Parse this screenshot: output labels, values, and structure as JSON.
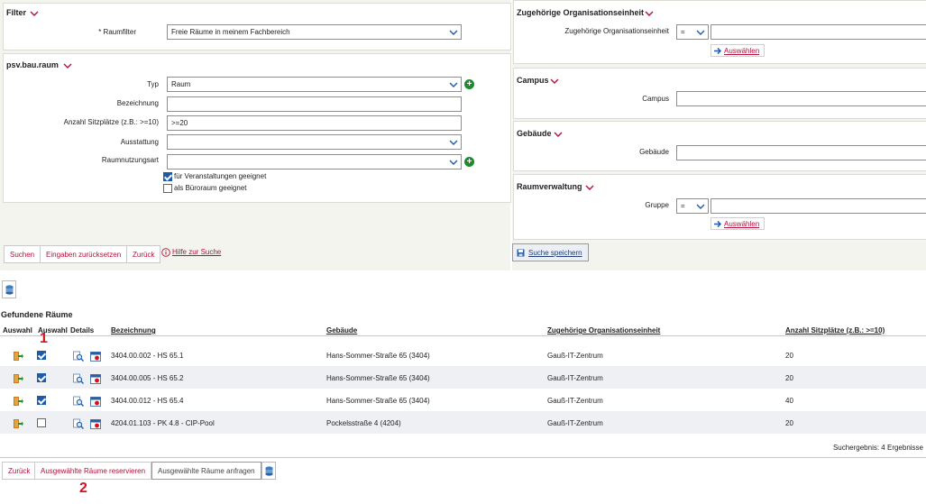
{
  "filter": {
    "title": "Filter",
    "raumfilter_label": "* Raumfilter",
    "raumfilter_value": "Freie Räume in meinem Fachbereich"
  },
  "psv": {
    "title": "psv.bau.raum",
    "typ_label": "Typ",
    "typ_value": "Raum",
    "bezeichnung_label": "Bezeichnung",
    "bezeichnung_value": "",
    "sitzplaetze_label": "Anzahl Sitzplätze (z.B.: >=10)",
    "sitzplaetze_value": ">=20",
    "ausstattung_label": "Ausstattung",
    "ausstattung_value": "",
    "raumnutzungsart_label": "Raumnutzungsart",
    "raumnutzungsart_value": "",
    "cb_veranstaltungen": "für Veranstaltungen geeignet",
    "cb_veranstaltungen_checked": true,
    "cb_buero": "als Büroraum geeignet",
    "cb_buero_checked": false
  },
  "left_buttons": {
    "suchen": "Suchen",
    "reset": "Eingaben zurücksetzen",
    "zurueck": "Zurück",
    "hilfe": "Hilfe zur Suche"
  },
  "org": {
    "title": "Zugehörige Organisationseinheit",
    "label": "Zugehörige Organisationseinheit",
    "operator": "=",
    "value": "",
    "auswaehlen": "Auswählen"
  },
  "campus": {
    "title": "Campus",
    "label": "Campus",
    "value": ""
  },
  "gebaeude": {
    "title": "Gebäude",
    "label": "Gebäude",
    "value": ""
  },
  "raumverwaltung": {
    "title": "Raumverwaltung",
    "label": "Gruppe",
    "operator": "=",
    "value": "",
    "auswaehlen": "Auswählen"
  },
  "save_search": "Suche speichern",
  "results": {
    "title": "Gefundene Räume",
    "headers": {
      "auswahl1": "Auswahl",
      "auswahl2": "Auswahl",
      "details": "Details",
      "bezeichnung": "Bezeichnung",
      "gebaeude": "Gebäude",
      "org": "Zugehörige Organisationseinheit",
      "sitzplaetze": "Anzahl Sitzplätze (z.B.: >=10)"
    },
    "rows": [
      {
        "bezeichnung": "3404.00.002 - HS 65.1",
        "gebaeude": "Hans-Sommer-Straße 65 (3404)",
        "org": "Gauß-IT-Zentrum",
        "sitzplaetze": "20",
        "checked": true
      },
      {
        "bezeichnung": "3404.00.005 - HS 65.2",
        "gebaeude": "Hans-Sommer-Straße 65 (3404)",
        "org": "Gauß-IT-Zentrum",
        "sitzplaetze": "20",
        "checked": true
      },
      {
        "bezeichnung": "3404.00.012 - HS 65.4",
        "gebaeude": "Hans-Sommer-Straße 65 (3404)",
        "org": "Gauß-IT-Zentrum",
        "sitzplaetze": "40",
        "checked": true
      },
      {
        "bezeichnung": "4204.01.103 - PK 4.8 - CIP-Pool",
        "gebaeude": "Pockelsstraße 4 (4204)",
        "org": "Gauß-IT-Zentrum",
        "sitzplaetze": "20",
        "checked": false
      }
    ],
    "summary": "Suchergebnis: 4 Ergebnisse"
  },
  "bottom_buttons": {
    "zurueck": "Zurück",
    "reservieren": "Ausgewählte Räume reservieren",
    "anfragen": "Ausgewählte Räume anfragen"
  },
  "annotations": {
    "one": "1",
    "two": "2"
  },
  "colors": {
    "accent": "#b0123a",
    "checkbox": "#1f5aa8",
    "plus": "#1e8a2e",
    "annotation": "#d4121e"
  }
}
